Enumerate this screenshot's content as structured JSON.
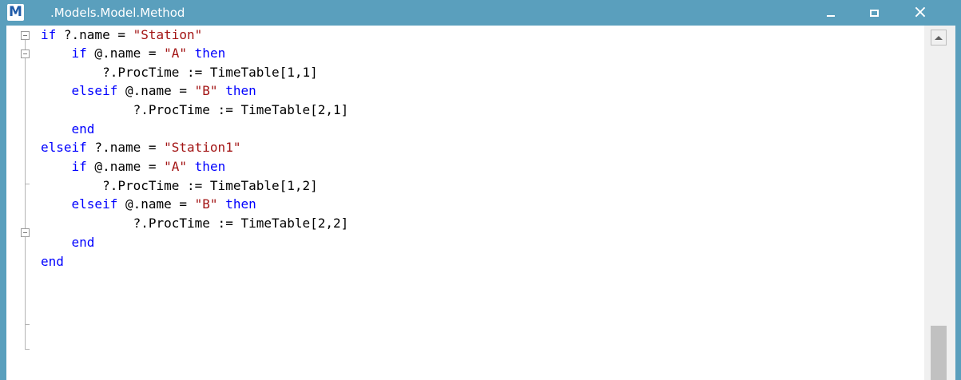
{
  "window": {
    "title": ".Models.Model.Method",
    "logo_letter": "M",
    "titlebar_color": "#5a9fbd",
    "buttons": [
      "minimize-icon",
      "maximize-icon",
      "close-icon"
    ],
    "close_glyph": "×"
  },
  "editor": {
    "colors": {
      "keyword": "#0000ff",
      "string": "#a31515",
      "text": "#000000"
    },
    "lines": [
      [
        {
          "t": "if",
          "c": "kw"
        },
        {
          "t": " ?.name = "
        },
        {
          "t": "\"Station\"",
          "c": "str"
        }
      ],
      [
        {
          "t": "    "
        },
        {
          "t": "if",
          "c": "kw"
        },
        {
          "t": " @.name = "
        },
        {
          "t": "\"A\"",
          "c": "str"
        },
        {
          "t": " "
        },
        {
          "t": "then",
          "c": "kw"
        }
      ],
      [
        {
          "t": "        ?.ProcTime := TimeTable[1,1]"
        }
      ],
      [
        {
          "t": "    "
        },
        {
          "t": "elseif",
          "c": "kw"
        },
        {
          "t": " @.name = "
        },
        {
          "t": "\"B\"",
          "c": "str"
        },
        {
          "t": " "
        },
        {
          "t": "then",
          "c": "kw"
        }
      ],
      [
        {
          "t": "            ?.ProcTime := TimeTable[2,1]"
        }
      ],
      [
        {
          "t": "    "
        },
        {
          "t": "end",
          "c": "kw"
        }
      ],
      [
        {
          "t": "elseif",
          "c": "kw"
        },
        {
          "t": " ?.name = "
        },
        {
          "t": "\"Station1\"",
          "c": "str"
        }
      ],
      [
        {
          "t": "    "
        },
        {
          "t": "if",
          "c": "kw"
        },
        {
          "t": " @.name = "
        },
        {
          "t": "\"A\"",
          "c": "str"
        },
        {
          "t": " "
        },
        {
          "t": "then",
          "c": "kw"
        }
      ],
      [
        {
          "t": "        ?.ProcTime := TimeTable[1,2]"
        }
      ],
      [
        {
          "t": "    "
        },
        {
          "t": "elseif",
          "c": "kw"
        },
        {
          "t": " @.name = "
        },
        {
          "t": "\"B\"",
          "c": "str"
        },
        {
          "t": " "
        },
        {
          "t": "then",
          "c": "kw"
        }
      ],
      [
        {
          "t": "            ?.ProcTime := TimeTable[2,2]"
        }
      ],
      [
        {
          "t": "    "
        },
        {
          "t": "end",
          "c": "kw"
        }
      ],
      [
        {
          "t": "end",
          "c": "kw"
        }
      ]
    ]
  },
  "scrollbar": {
    "up_icon": "scroll-up-arrow-icon"
  }
}
